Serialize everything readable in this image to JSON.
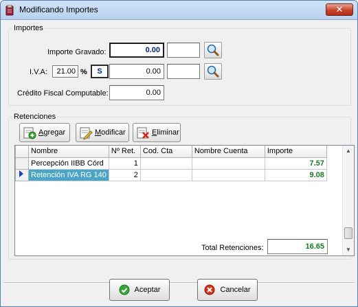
{
  "window": {
    "title": "Modificando Importes",
    "close_glyph": "✕"
  },
  "importes": {
    "title": "Importes",
    "gravado": {
      "label": "Importe Gravado:",
      "value": "0.00"
    },
    "iva": {
      "label": "I.V.A:",
      "rate": "21.00",
      "percent": "%",
      "code": "S",
      "value": "0.00"
    },
    "credito": {
      "label": "Crédito Fiscal Computable:",
      "value": "0.00"
    }
  },
  "retenciones": {
    "title": "Retenciones",
    "toolbar": {
      "agregar": {
        "first": "A",
        "rest": "gregar"
      },
      "modificar": {
        "first": "M",
        "rest": "odificar"
      },
      "eliminar": {
        "first": "E",
        "rest": "liminar"
      }
    },
    "columns": [
      "Nombre",
      "Nº Ret.",
      "Cod. Cta",
      "Nombre Cuenta",
      "Importe"
    ],
    "rows": [
      {
        "nombre": "Percepción IIBB Córd",
        "nro": "1",
        "cod": "",
        "cuenta": "",
        "importe": "7.57"
      },
      {
        "nombre": "Retención IVA RG 140",
        "nro": "2",
        "cod": "",
        "cuenta": "",
        "importe": "9.08"
      }
    ],
    "total": {
      "label": "Total Retenciones:",
      "value": "16.65"
    }
  },
  "buttons": {
    "aceptar": "Aceptar",
    "cancelar": "Cancelar"
  },
  "colors": {
    "title_bar": "#c4dbf2",
    "total_green": "#137a1d",
    "selected_row": "#4aa5c6"
  },
  "icons": [
    "app-icon",
    "close-icon",
    "search-icon",
    "add-icon",
    "edit-icon",
    "delete-icon",
    "row-pointer-icon",
    "accept-icon",
    "cancel-icon"
  ]
}
